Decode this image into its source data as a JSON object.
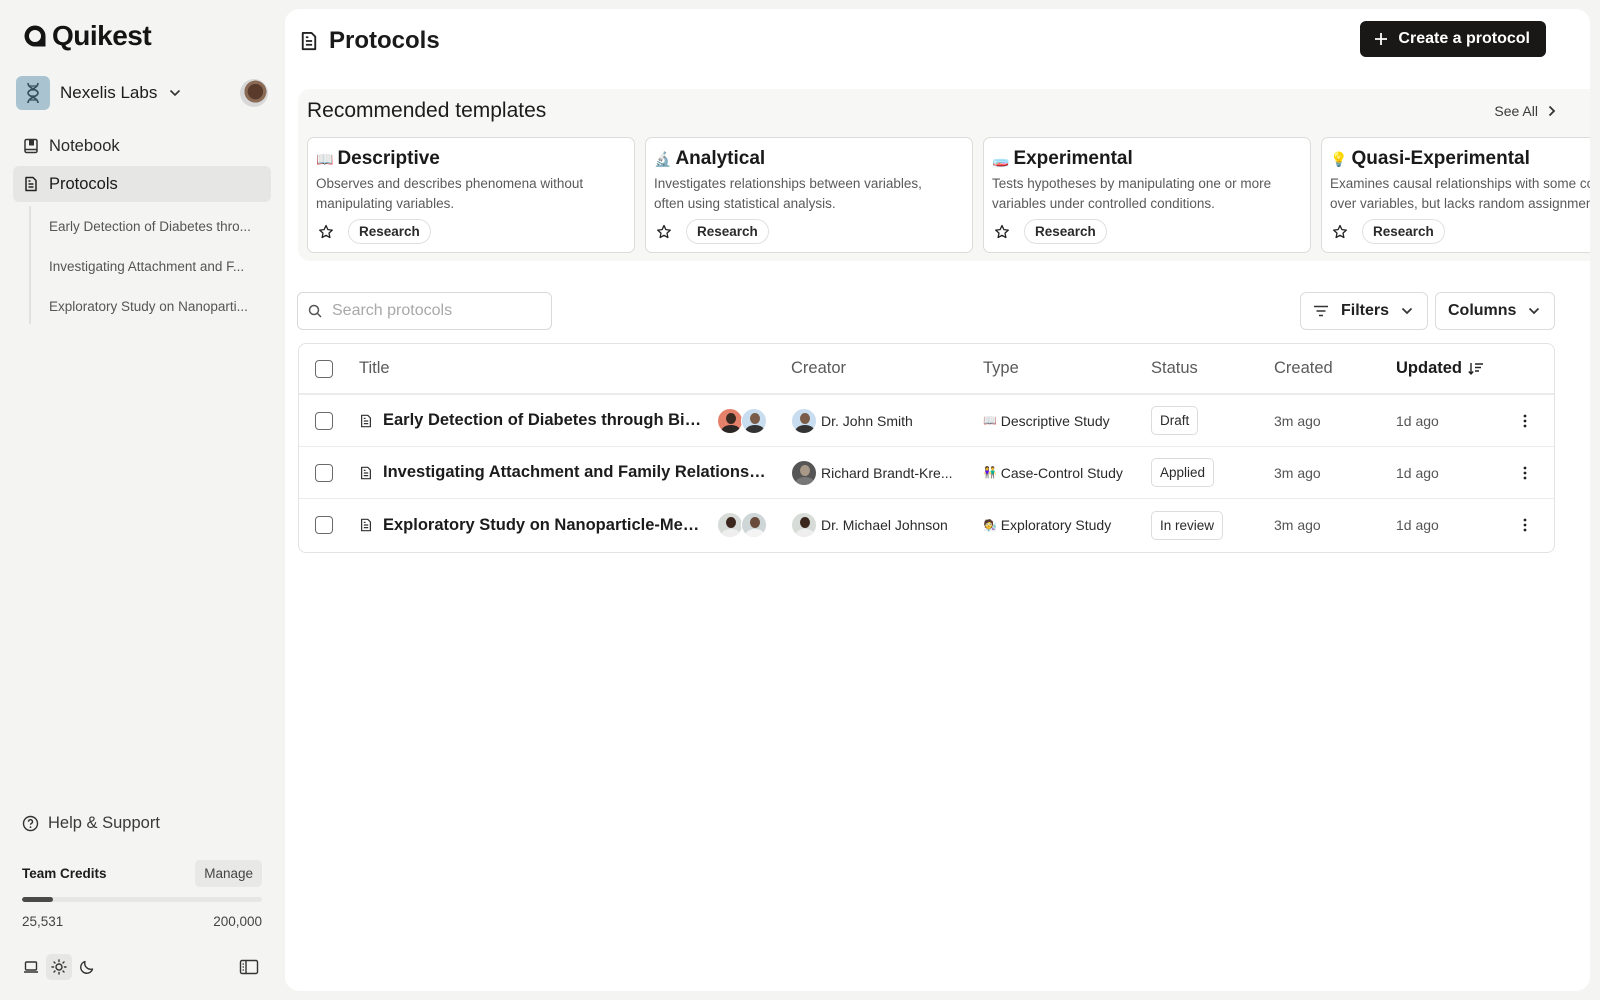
{
  "app": {
    "name": "Quikest"
  },
  "workspace": {
    "name": "Nexelis Labs"
  },
  "sidebar": {
    "nav": [
      {
        "label": "Notebook",
        "icon": "notebook-icon",
        "active": false
      },
      {
        "label": "Protocols",
        "icon": "document-icon",
        "active": true
      }
    ],
    "sub_items": [
      {
        "label": "Early Detection of Diabetes thro..."
      },
      {
        "label": "Investigating Attachment and F..."
      },
      {
        "label": "Exploratory Study on Nanoparti..."
      }
    ],
    "help_label": "Help & Support",
    "credits": {
      "title": "Team Credits",
      "manage_label": "Manage",
      "used": "25,531",
      "total": "200,000",
      "used_fraction": 0.1277
    },
    "theme": {
      "options": [
        "system",
        "light",
        "dark"
      ],
      "selected": "light"
    }
  },
  "header": {
    "title": "Protocols",
    "create_label": "Create a protocol"
  },
  "templates": {
    "title": "Recommended templates",
    "see_all_label": "See All",
    "cards": [
      {
        "emoji": "📖",
        "title": "Descriptive",
        "desc_line1": "Observes and describes phenomena without",
        "desc_line2": "manipulating variables.",
        "tag": "Research"
      },
      {
        "emoji": "🔬",
        "title": "Analytical",
        "desc_line1": "Investigates relationships between variables,",
        "desc_line2": "often using statistical analysis.",
        "tag": "Research"
      },
      {
        "emoji": "🧫",
        "title": "Experimental",
        "desc_line1": "Tests hypotheses by manipulating one or more",
        "desc_line2": "variables under controlled conditions.",
        "tag": "Research"
      },
      {
        "emoji": "💡",
        "title": "Quasi-Experimental",
        "desc_line1": "Examines causal relationships with some control",
        "desc_line2": "over variables, but lacks random assignment.",
        "tag": "Research"
      }
    ]
  },
  "search": {
    "placeholder": "Search protocols",
    "value": ""
  },
  "toolbar": {
    "filters_label": "Filters",
    "columns_label": "Columns"
  },
  "table": {
    "columns": {
      "title": "Title",
      "creator": "Creator",
      "type": "Type",
      "status": "Status",
      "created": "Created",
      "updated": "Updated"
    },
    "sort": {
      "column": "updated",
      "direction": "desc"
    },
    "rows": [
      {
        "title": "Early Detection of Diabetes through Biom...",
        "collaborators": [
          "collaborator-1",
          "collaborator-2"
        ],
        "creator": "Dr. John Smith",
        "type_emoji": "📖",
        "type": "Descriptive Study",
        "status": "Draft",
        "created": "3m ago",
        "updated": "1d ago"
      },
      {
        "title": "Investigating Attachment and Family Relationship...",
        "collaborators": [],
        "creator": "Richard Brandt-Kre...",
        "type_emoji": "👫",
        "type": "Case-Control Study",
        "status": "Applied",
        "created": "3m ago",
        "updated": "1d ago"
      },
      {
        "title": "Exploratory Study on Nanoparticle-Mediat...",
        "collaborators": [
          "collaborator-1",
          "collaborator-2"
        ],
        "creator": "Dr. Michael Johnson",
        "type_emoji": "🧑‍🔬",
        "type": "Exploratory Study",
        "status": "In review",
        "created": "3m ago",
        "updated": "1d ago"
      }
    ]
  },
  "colors": {
    "primary_button": "#1a1817",
    "sidebar_bg": "#f4f4f3",
    "active_nav": "#e6e6e4",
    "workspace_avatar": "#a9c4d0"
  }
}
